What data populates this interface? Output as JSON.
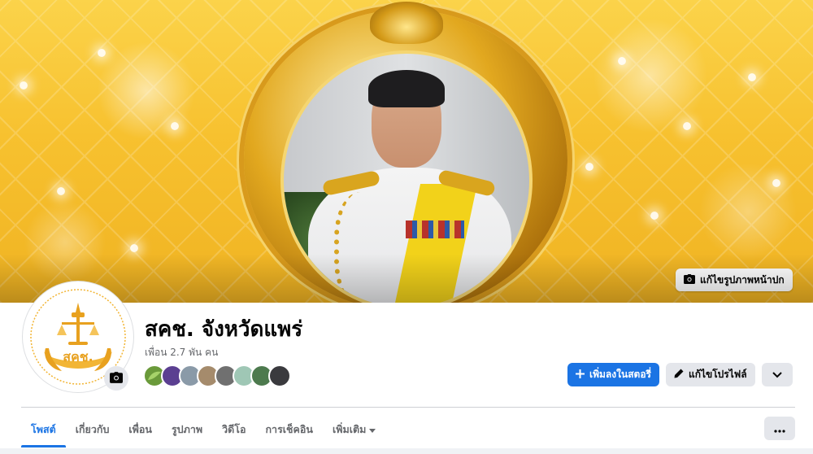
{
  "cover": {
    "edit_cover_label": "แก้ไขรูปภาพหน้าปก",
    "background_color": "#f7c12f",
    "frame_color": "#d89a1c"
  },
  "avatar": {
    "logo_text": "สคช.",
    "logo_color": "#e8a11f"
  },
  "profile": {
    "name": "สคช. จังหวัดแพร่",
    "friends_count": "เพื่อน 2.7 พัน คน"
  },
  "actions": {
    "add_story_label": "เพิ่มลงในสตอรี่",
    "edit_profile_label": "แก้ไขโปรไฟล์",
    "accent": "#1b74e4"
  },
  "tabs": [
    {
      "label": "โพสต์",
      "active": true
    },
    {
      "label": "เกี่ยวกับ",
      "active": false
    },
    {
      "label": "เพื่อน",
      "active": false
    },
    {
      "label": "รูปภาพ",
      "active": false
    },
    {
      "label": "วิดีโอ",
      "active": false
    },
    {
      "label": "การเช็คอิน",
      "active": false
    },
    {
      "label": "เพิ่มเติม",
      "active": false
    }
  ],
  "icons": {
    "camera": "camera-icon",
    "plus": "plus-icon",
    "pencil": "pencil-icon",
    "chevron": "chevron-down-icon",
    "ellipsis": "ellipsis-icon"
  }
}
